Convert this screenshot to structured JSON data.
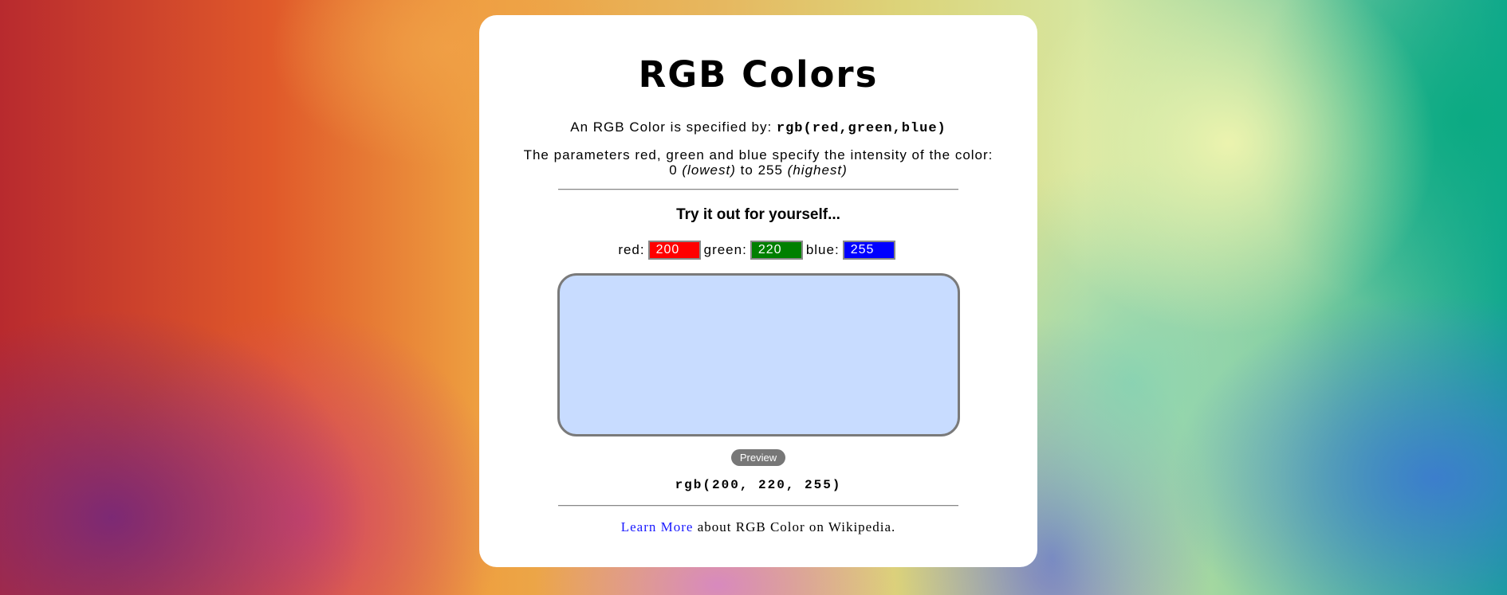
{
  "page": {
    "title": "RGB Colors"
  },
  "intro": {
    "prefix": "An RGB Color is specified by:",
    "code": "rgb(red,green,blue)"
  },
  "params": {
    "line1": "The parameters red, green and blue specify the intensity of the color:",
    "low_value": "0",
    "low_label": "(lowest)",
    "to": "to",
    "high_value": "255",
    "high_label": "(highest)"
  },
  "tryit": {
    "heading": "Try it out for yourself..."
  },
  "inputs": {
    "red": {
      "label": "red:",
      "value": "200",
      "bg": "#ff0000"
    },
    "green": {
      "label": "green:",
      "value": "220",
      "bg": "#008000"
    },
    "blue": {
      "label": "blue:",
      "value": "255",
      "bg": "#0000ff"
    }
  },
  "preview": {
    "color": "#c8dcff",
    "button_label": "Preview",
    "output": "rgb(200, 220, 255)"
  },
  "footer": {
    "link_label": "Learn More",
    "suffix": "about RGB Color on Wikipedia."
  }
}
